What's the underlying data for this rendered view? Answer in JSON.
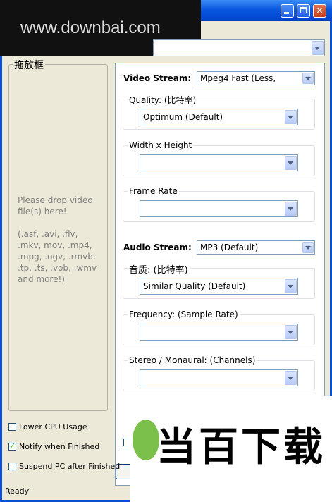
{
  "watermark": "www.downbai.com",
  "titlebar": {
    "buttons": [
      "minimize",
      "maximize",
      "close"
    ],
    "close_glyph": "✕"
  },
  "drop_area": {
    "label": "拖放框",
    "hint": "Please drop video file(s) here!",
    "formats": "(.asf, .avi, .flv, .mkv, mov, .mp4, .mpg, .ogv, .rmvb, .tp, .ts, .vob, .wmv and more!)"
  },
  "video": {
    "heading": "Video Stream:",
    "codec": "Mpeg4  Fast      (Less,",
    "quality_label": "Quality: (比特率)",
    "quality_value": "Optimum  (Default)",
    "size_label": "Width x Height",
    "size_value": "",
    "framerate_label": "Frame Rate",
    "framerate_value": ""
  },
  "audio": {
    "heading": "Audio Stream:",
    "codec": "MP3  (Default)",
    "quality_label": "音质: (比特率)",
    "quality_value": "Similar Quality  (Default)",
    "frequency_label": "Frequency: (Sample Rate)",
    "frequency_value": "",
    "channels_label": "Stereo / Monaural: (Channels)"
  },
  "options": [
    {
      "label": "Lower CPU Usage",
      "checked": false
    },
    {
      "label": "Notify when Finished",
      "checked": true
    },
    {
      "label": "Suspend PC after Finished",
      "checked": false
    }
  ],
  "status": "Ready",
  "logo": {
    "text": "当百下载",
    "brand_color": "#7bc04a"
  }
}
